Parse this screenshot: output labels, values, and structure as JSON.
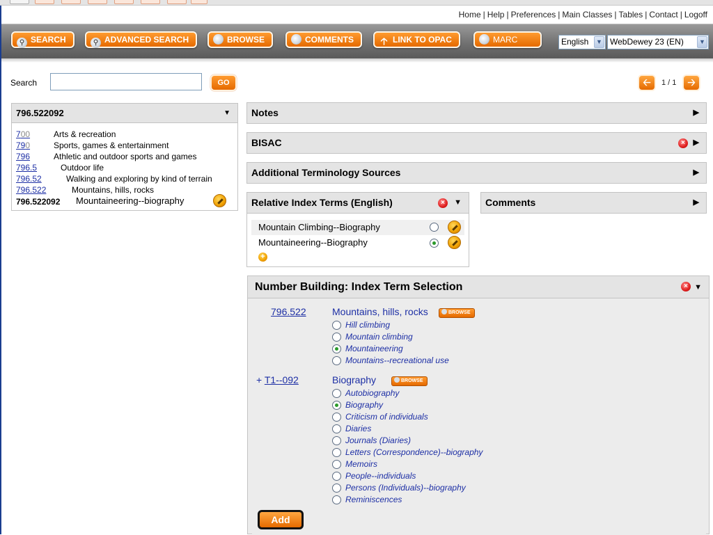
{
  "toplinks": {
    "home": "Home",
    "help": "Help",
    "preferences": "Preferences",
    "main_classes": "Main Classes",
    "tables": "Tables",
    "contact": "Contact",
    "logoff": "Logoff"
  },
  "toolbar": {
    "search": "SEARCH",
    "advanced_search": "ADVANCED SEARCH",
    "browse": "BROWSE",
    "comments": "COMMENTS",
    "link_to_opac": "LINK TO OPAC",
    "marc": "MARC",
    "language_select": "English",
    "edition_select": "WebDewey 23 (EN)"
  },
  "search": {
    "label": "Search",
    "value": "",
    "go": "GO"
  },
  "pager": {
    "text": "1 / 1"
  },
  "hierarchy": {
    "title": "796.522092",
    "rows": [
      {
        "num_a": "7",
        "num_b": "00",
        "desc": "Arts & recreation"
      },
      {
        "num_a": "79",
        "num_b": "0",
        "desc": "Sports, games & entertainment"
      },
      {
        "num_a": "796",
        "num_b": "",
        "desc": "Athletic and outdoor sports and games"
      },
      {
        "num_a": "796.5",
        "num_b": "",
        "desc": "Outdoor life"
      },
      {
        "num_a": "796.52",
        "num_b": "",
        "desc": "Walking and exploring by kind of terrain"
      },
      {
        "num_a": "796.522",
        "num_b": "",
        "desc": "Mountains, hills, rocks"
      },
      {
        "num_a": "796.522092",
        "num_b": "",
        "desc": "Mountaineering--biography"
      }
    ]
  },
  "sections": {
    "notes": "Notes",
    "bisac": "BISAC",
    "additional": "Additional Terminology Sources",
    "relative_index": "Relative Index Terms (English)",
    "comments": "Comments"
  },
  "relative_terms": [
    {
      "label": "Mountain Climbing--Biography",
      "selected": false
    },
    {
      "label": "Mountaineering--Biography",
      "selected": true
    }
  ],
  "number_building": {
    "title": "Number Building: Index Term Selection",
    "groups": [
      {
        "number": "796.522",
        "caption": "Mountains, hills, rocks",
        "options": [
          "Hill climbing",
          "Mountain climbing",
          "Mountaineering",
          "Mountains--recreational use"
        ],
        "selected": 2
      },
      {
        "prefix": "+ ",
        "number": "T1--092",
        "caption": "Biography",
        "options": [
          "Autobiography",
          "Biography",
          "Criticism of individuals",
          "Diaries",
          "Journals (Diaries)",
          "Letters (Correspondence)--biography",
          "Memoirs",
          "People--individuals",
          "Persons (Individuals)--biography",
          "Reminiscences"
        ],
        "selected": 1
      }
    ],
    "browse_label": "BROWSE",
    "add": "Add"
  },
  "colors": {
    "accent": "#f07a10",
    "link": "#1d2fa5",
    "panel_header": "#e4e4e4",
    "close": "#e02020"
  }
}
